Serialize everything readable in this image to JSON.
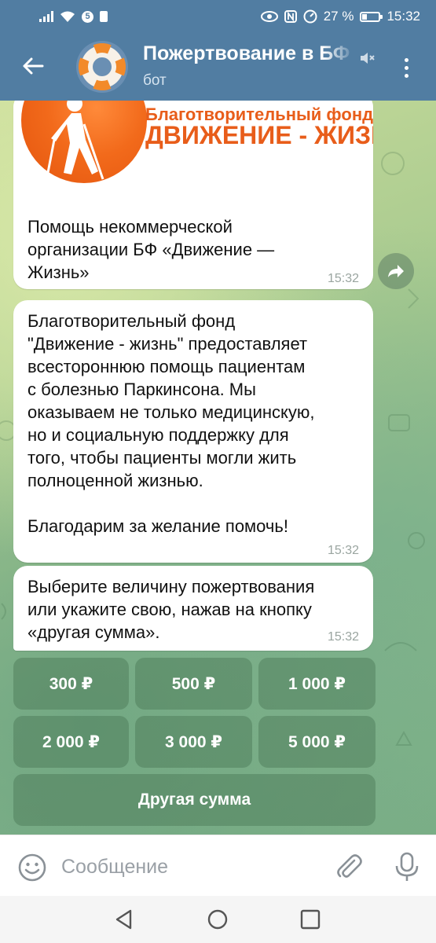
{
  "status_bar": {
    "sim_badge": "5",
    "battery": "27 %",
    "time": "15:32"
  },
  "header": {
    "title": "Пожертвование в БФ",
    "subtitle": "бот"
  },
  "messages": [
    {
      "banner_line1": "Благотворительный фонд",
      "banner_line2": "ДВИЖЕНИЕ - ЖИЗНЬ",
      "text": "Помощь некоммерческой\nорганизации БФ «Движение —\nЖизнь»",
      "time": "15:32"
    },
    {
      "text": "Благотворительный фонд\n\"Движение - жизнь\" предоставляет\nвсестороннюю помощь пациентам\nс болезнью Паркинсона. Мы\nоказываем не только медицинскую,\nно и социальную поддержку для\nтого, чтобы пациенты могли жить\nполноценной жизнью.\n\nБлагодарим за желание помочь!",
      "time": "15:32"
    },
    {
      "text": "Выберите величину пожертвования\nили укажите свою, нажав на кнопку\n«другая сумма».",
      "time": "15:32"
    }
  ],
  "keyboard": {
    "buttons": [
      "300 ₽",
      "500 ₽",
      "1 000 ₽",
      "2 000 ₽",
      "3 000 ₽",
      "5 000 ₽",
      "Другая сумма"
    ]
  },
  "input": {
    "placeholder": "Сообщение",
    "value": ""
  },
  "colors": {
    "header_bg": "#517da2",
    "bubble_bg": "#ffffff",
    "banner_orange": "#e85d1a"
  },
  "icons": {
    "back": "arrow-left-icon",
    "mute": "muted-speaker-icon",
    "menu": "more-vertical-icon",
    "share": "share-arrow-icon",
    "emoji": "smiley-icon",
    "attach": "paperclip-icon",
    "mic": "microphone-icon"
  }
}
